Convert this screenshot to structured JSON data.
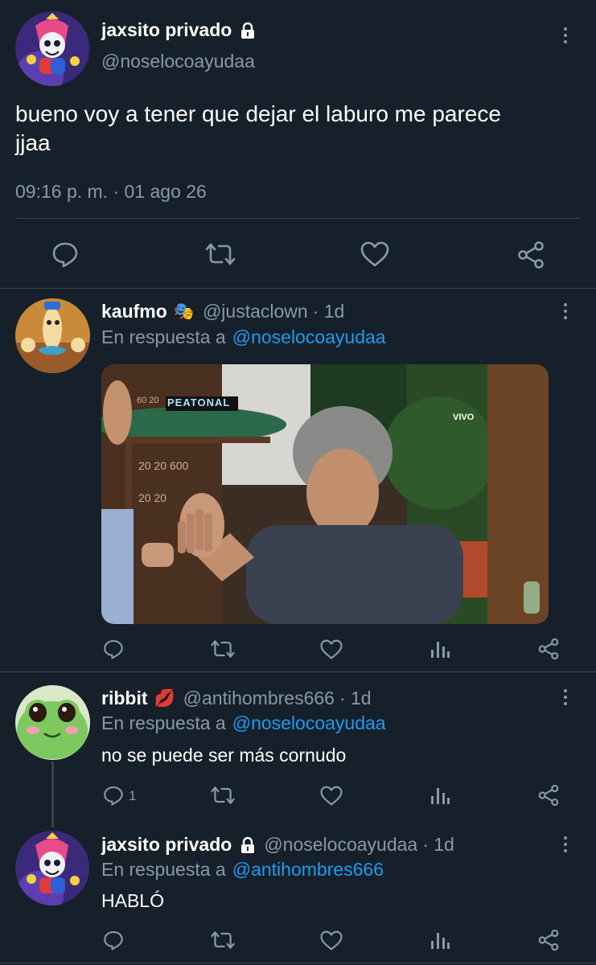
{
  "main_tweet": {
    "author_name": "jaxsito privado",
    "author_handle": "@noselocoayudaa",
    "text_line1": "bueno voy a tener que dejar el laburo me parece",
    "text_line2": "jjaa",
    "timestamp": "09:16 p. m. · 01 ago 26"
  },
  "replies": [
    {
      "author_name": "kaufmo",
      "author_emoji": "🎭",
      "author_handle": "@justaclown",
      "time": "· 1d",
      "reply_prefix": "En respuesta a",
      "reply_to": "@noselocoayudaa",
      "media_badge_top": "PEATONAL",
      "media_badge_right": "VIVO",
      "media_numbers_1": "60 20",
      "media_numbers_2": "20 20 600",
      "media_numbers_3": "20 20"
    },
    {
      "author_name": "ribbit",
      "author_emoji": "💋",
      "author_handle": "@antihombres666",
      "time": "· 1d",
      "reply_prefix": "En respuesta a",
      "reply_to": "@noselocoayudaa",
      "text": "no se puede ser más cornudo",
      "reply_count": "1"
    },
    {
      "author_name": "jaxsito privado",
      "author_handle": "@noselocoayudaa",
      "time": "· 1d",
      "reply_prefix": "En respuesta a",
      "reply_to": "@antihombres666",
      "text": "HABLÓ"
    }
  ],
  "colors": {
    "background": "#15202b",
    "muted": "#8899a6",
    "link": "#1d9bf0",
    "divider": "#38444d"
  },
  "icons": [
    "lock-icon",
    "more-icon",
    "reply-icon",
    "retweet-icon",
    "like-icon",
    "share-icon",
    "analytics-icon"
  ]
}
